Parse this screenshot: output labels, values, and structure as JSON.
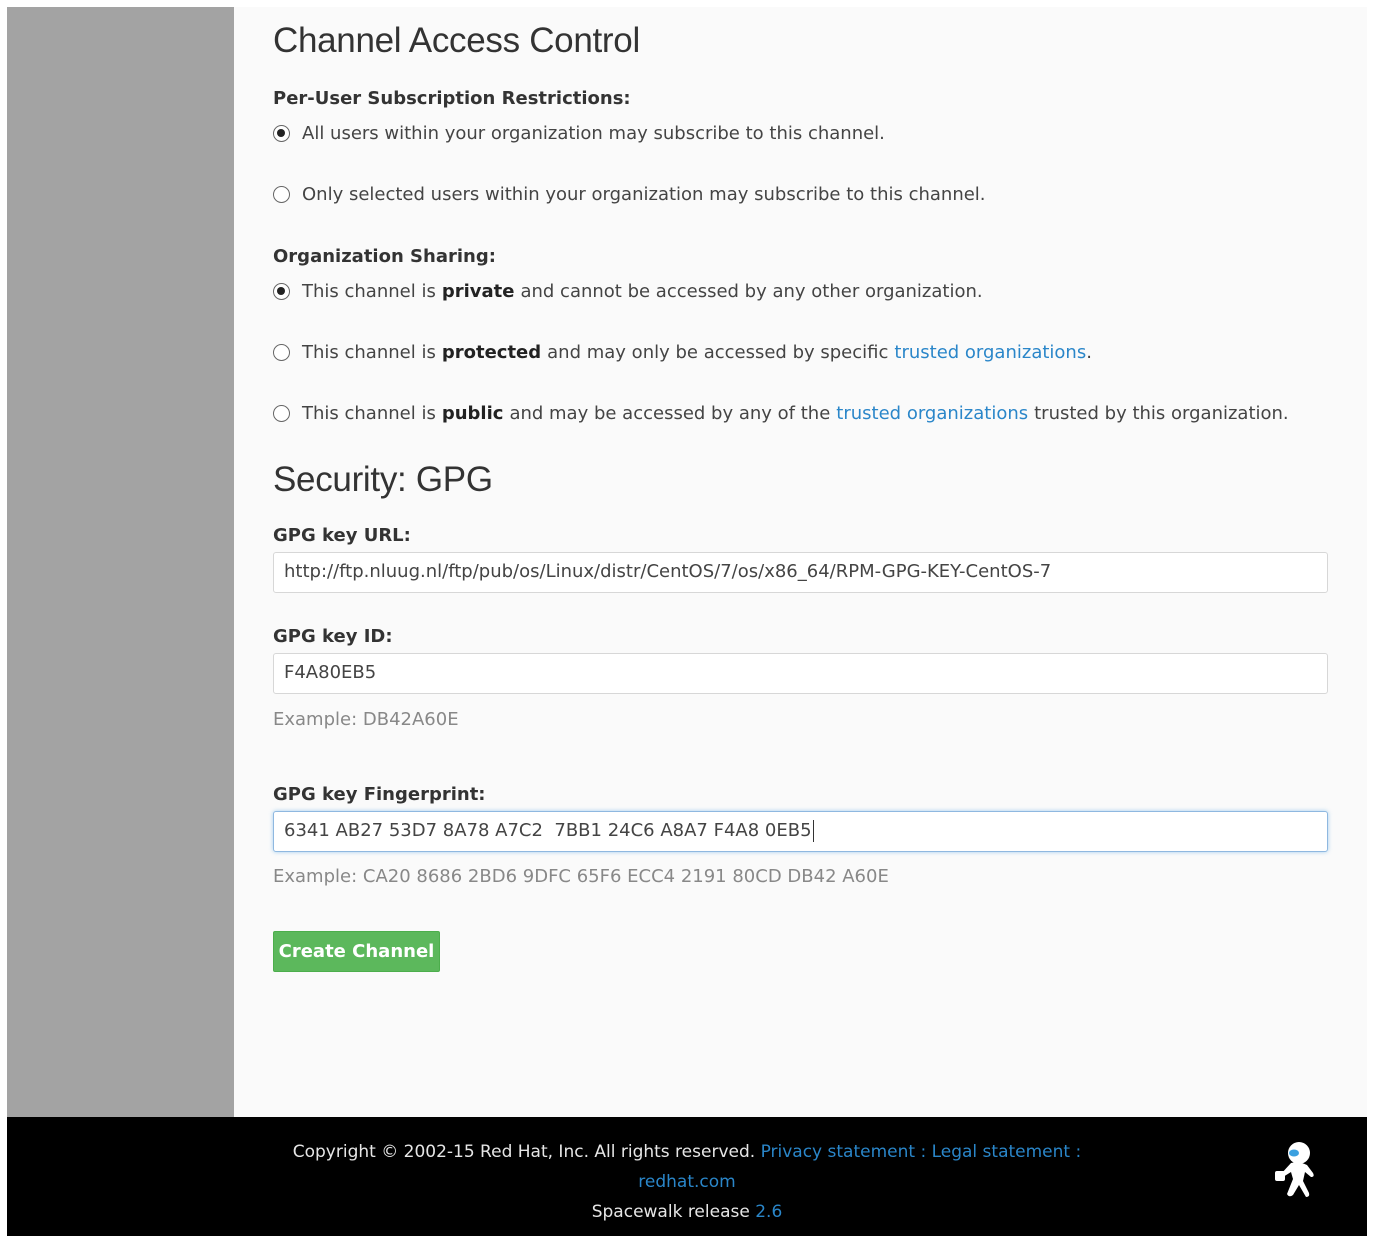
{
  "access": {
    "title": "Channel Access Control",
    "per_user_label": "Per-User Subscription Restrictions:",
    "per_user_options": [
      {
        "text": "All users within your organization may subscribe to this channel.",
        "checked": true
      },
      {
        "text": "Only selected users within your organization may subscribe to this channel.",
        "checked": false
      }
    ],
    "sharing_label": "Organization Sharing:",
    "sharing_options": {
      "private": {
        "prefix": "This channel is",
        "bold": "private",
        "suffix": "and cannot be accessed by any other organization.",
        "checked": true
      },
      "protected": {
        "prefix": "This channel is",
        "bold": "protected",
        "middle": "and may only be accessed by specific",
        "link": "trusted organizations",
        "suffix": ".",
        "checked": false
      },
      "public": {
        "prefix": "This channel is",
        "bold": "public",
        "middle": "and may be accessed by any of the",
        "link": "trusted organizations",
        "suffix": "trusted by this organization.",
        "checked": false
      }
    }
  },
  "security": {
    "title": "Security: GPG",
    "key_url_label": "GPG key URL:",
    "key_url_value": "http://ftp.nluug.nl/ftp/pub/os/Linux/distr/CentOS/7/os/x86_64/RPM-GPG-KEY-CentOS-7",
    "key_id_label": "GPG key ID:",
    "key_id_value": "F4A80EB5",
    "key_id_hint": "Example: DB42A60E",
    "fingerprint_label": "GPG key Fingerprint:",
    "fingerprint_value": "6341 AB27 53D7 8A78 A7C2  7BB1 24C6 A8A7 F4A8 0EB5",
    "fingerprint_hint": "Example: CA20 8686 2BD6 9DFC 65F6 ECC4 2191 80CD DB42 A60E"
  },
  "actions": {
    "create_label": "Create Channel"
  },
  "footer": {
    "copyright": "Copyright © 2002-15 Red Hat, Inc. All rights reserved.",
    "privacy": "Privacy statement",
    "sep1": ":",
    "legal": "Legal statement",
    "sep2": ":",
    "redhat": "redhat.com",
    "release_prefix": "Spacewalk release",
    "release_version": "2.6"
  },
  "colors": {
    "sidebar": "#a3a3a3",
    "link": "#2a86c9",
    "button": "#5cb85c",
    "footer": "#000000"
  }
}
